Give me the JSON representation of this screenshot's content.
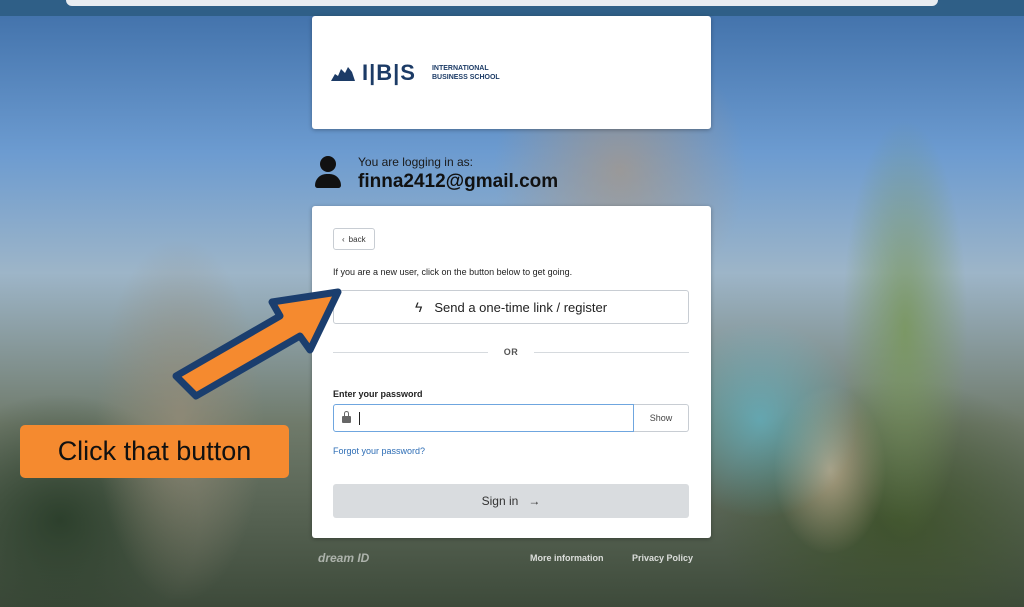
{
  "logo": {
    "mark": "I|B|S",
    "line1": "INTERNATIONAL",
    "line2": "BUSINESS SCHOOL"
  },
  "user": {
    "subtitle": "You are logging in as:",
    "email": "finna2412@gmail.com"
  },
  "login": {
    "back_label": "back",
    "new_user_hint": "If you are a new user, click on the button below to get going.",
    "send_link_label": "Send a one-time link / register",
    "or_label": "OR",
    "password_label": "Enter your password",
    "password_value": "",
    "show_label": "Show",
    "forgot_label": "Forgot your password?",
    "signin_label": "Sign in"
  },
  "footer": {
    "brand": "dream ID",
    "more_info": "More information",
    "privacy": "Privacy Policy"
  },
  "callout": {
    "text": "Click that button"
  },
  "colors": {
    "callout": "#f58a2f",
    "arrow_outline": "#1b3e6e",
    "accent": "#2d6db5"
  }
}
